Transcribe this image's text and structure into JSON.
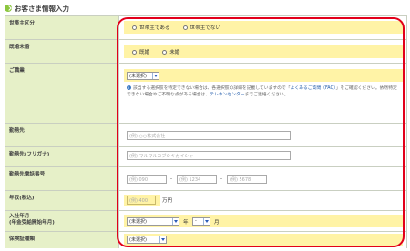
{
  "header": {
    "title": "お客さま情報入力"
  },
  "rows": {
    "householder": {
      "label": "世帯主区分",
      "options": [
        "世帯主である",
        "世帯主でない"
      ]
    },
    "marital": {
      "label": "既婚未婚",
      "options": [
        "既婚",
        "未婚"
      ]
    },
    "occupation": {
      "label": "ご職業",
      "select_value": "(未選択)",
      "note_pre": "該当する選択肢を特定できない場合は、各選択肢の詳細を記載していますので「",
      "note_link1": "よくあるご質問（FAQ）",
      "note_mid": "」をご確認ください。依然特定できない場合やご不明な点がある場合は、",
      "note_link2": "テレホンセンター",
      "note_post": "までご連絡ください。"
    },
    "employer": {
      "label": "勤務先",
      "placeholder": "(例) ○○株式会社"
    },
    "employer_kana": {
      "label": "勤務先(フリガナ)",
      "placeholder": "(例) マルマルカブシキガイシャ"
    },
    "employer_phone": {
      "label": "勤務先電話番号",
      "p1": "(例) 090",
      "p2": "(例) 1234",
      "p3": "(例) 5678",
      "sep": "-"
    },
    "income": {
      "label": "年収(税込)",
      "placeholder": "(例) 400",
      "unit": "万円"
    },
    "join_date": {
      "label_line1": "入社年月",
      "label_line2": "(年金受給開始年月)",
      "year_value": "(未選択)",
      "year_unit": "年",
      "month_value": "-",
      "month_unit": "月"
    },
    "insurance": {
      "label": "保険証種類",
      "select_value": "(未選択)"
    }
  },
  "colors": {
    "label_bg": "#e6f0c8",
    "highlight_bg": "#fff3a6",
    "frame": "#e2001a",
    "accent": "#8cc63f",
    "link": "#1a56a8"
  }
}
